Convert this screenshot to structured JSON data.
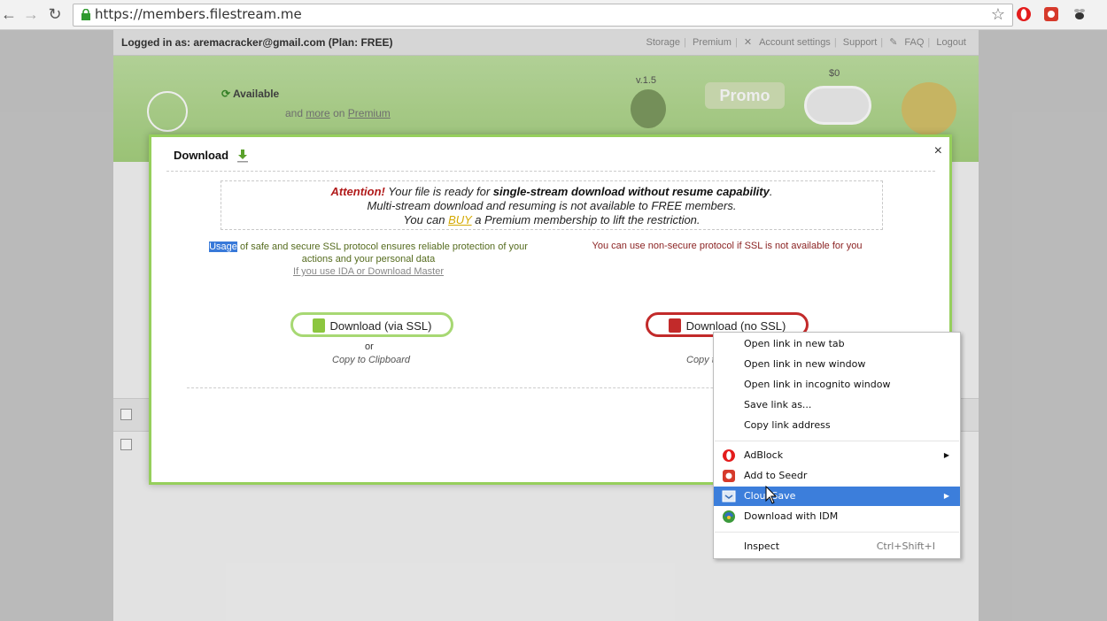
{
  "browser": {
    "url": "https://members.filestream.me",
    "extensions": [
      "opera-icon",
      "seedr-icon",
      "bee-icon"
    ]
  },
  "page": {
    "logged_in_text": "Logged in as: aremacracker@gmail.com (Plan: FREE)",
    "nav": [
      "Storage",
      "Premium",
      "Account settings",
      "Support",
      "FAQ",
      "Logout"
    ],
    "header": {
      "available": "Available",
      "and_more": "and",
      "more": "more",
      "on": "on",
      "premium_link": "Premium",
      "version": "v.1.5",
      "promo": "Promo",
      "price": "$0"
    }
  },
  "modal": {
    "title": "Download",
    "close": "×",
    "attention_label": "Attention!",
    "attention_line1_mid": "Your file is ready for",
    "attention_line1_bold": "single-stream download without resume capability",
    "attention_line1_end": ".",
    "attention_line2": "Multi-stream download and resuming is not available to FREE members.",
    "attention_line3_pre": "You can",
    "attention_line3_buy": "BUY",
    "attention_line3_post": "a Premium membership to lift the restriction.",
    "ssl_desc_highlight": "Usage",
    "ssl_desc_rest": "of safe and secure SSL protocol ensures reliable protection of your actions and your personal data",
    "ssl_link": "If you use IDA or Download Master",
    "nossl_desc": "You can use non-secure protocol if SSL is not available for you",
    "btn_ssl": "Download (via SSL)",
    "btn_nossl": "Download (no SSL)",
    "or": "or",
    "copy_ssl": "Copy to Clipboard",
    "copy_nossl": "Copy t",
    "colors": {
      "ssl_green": "#a7d873",
      "nossl_red": "#c22a2a",
      "attention_red": "#b11b1b"
    }
  },
  "context_menu": {
    "items": [
      {
        "label": "Open link in new tab"
      },
      {
        "label": "Open link in new window"
      },
      {
        "label": "Open link in incognito window"
      },
      {
        "label": "Save link as..."
      },
      {
        "label": "Copy link address"
      },
      {
        "label": "AdBlock",
        "icon": "adblock-icon",
        "submenu": true
      },
      {
        "label": "Add to Seedr",
        "icon": "seedr-icon"
      },
      {
        "label": "CloudSave",
        "icon": "cloudsave-icon",
        "submenu": true,
        "selected": true
      },
      {
        "label": "Download with IDM",
        "icon": "idm-icon"
      },
      {
        "label": "Inspect",
        "shortcut": "Ctrl+Shift+I"
      }
    ]
  }
}
